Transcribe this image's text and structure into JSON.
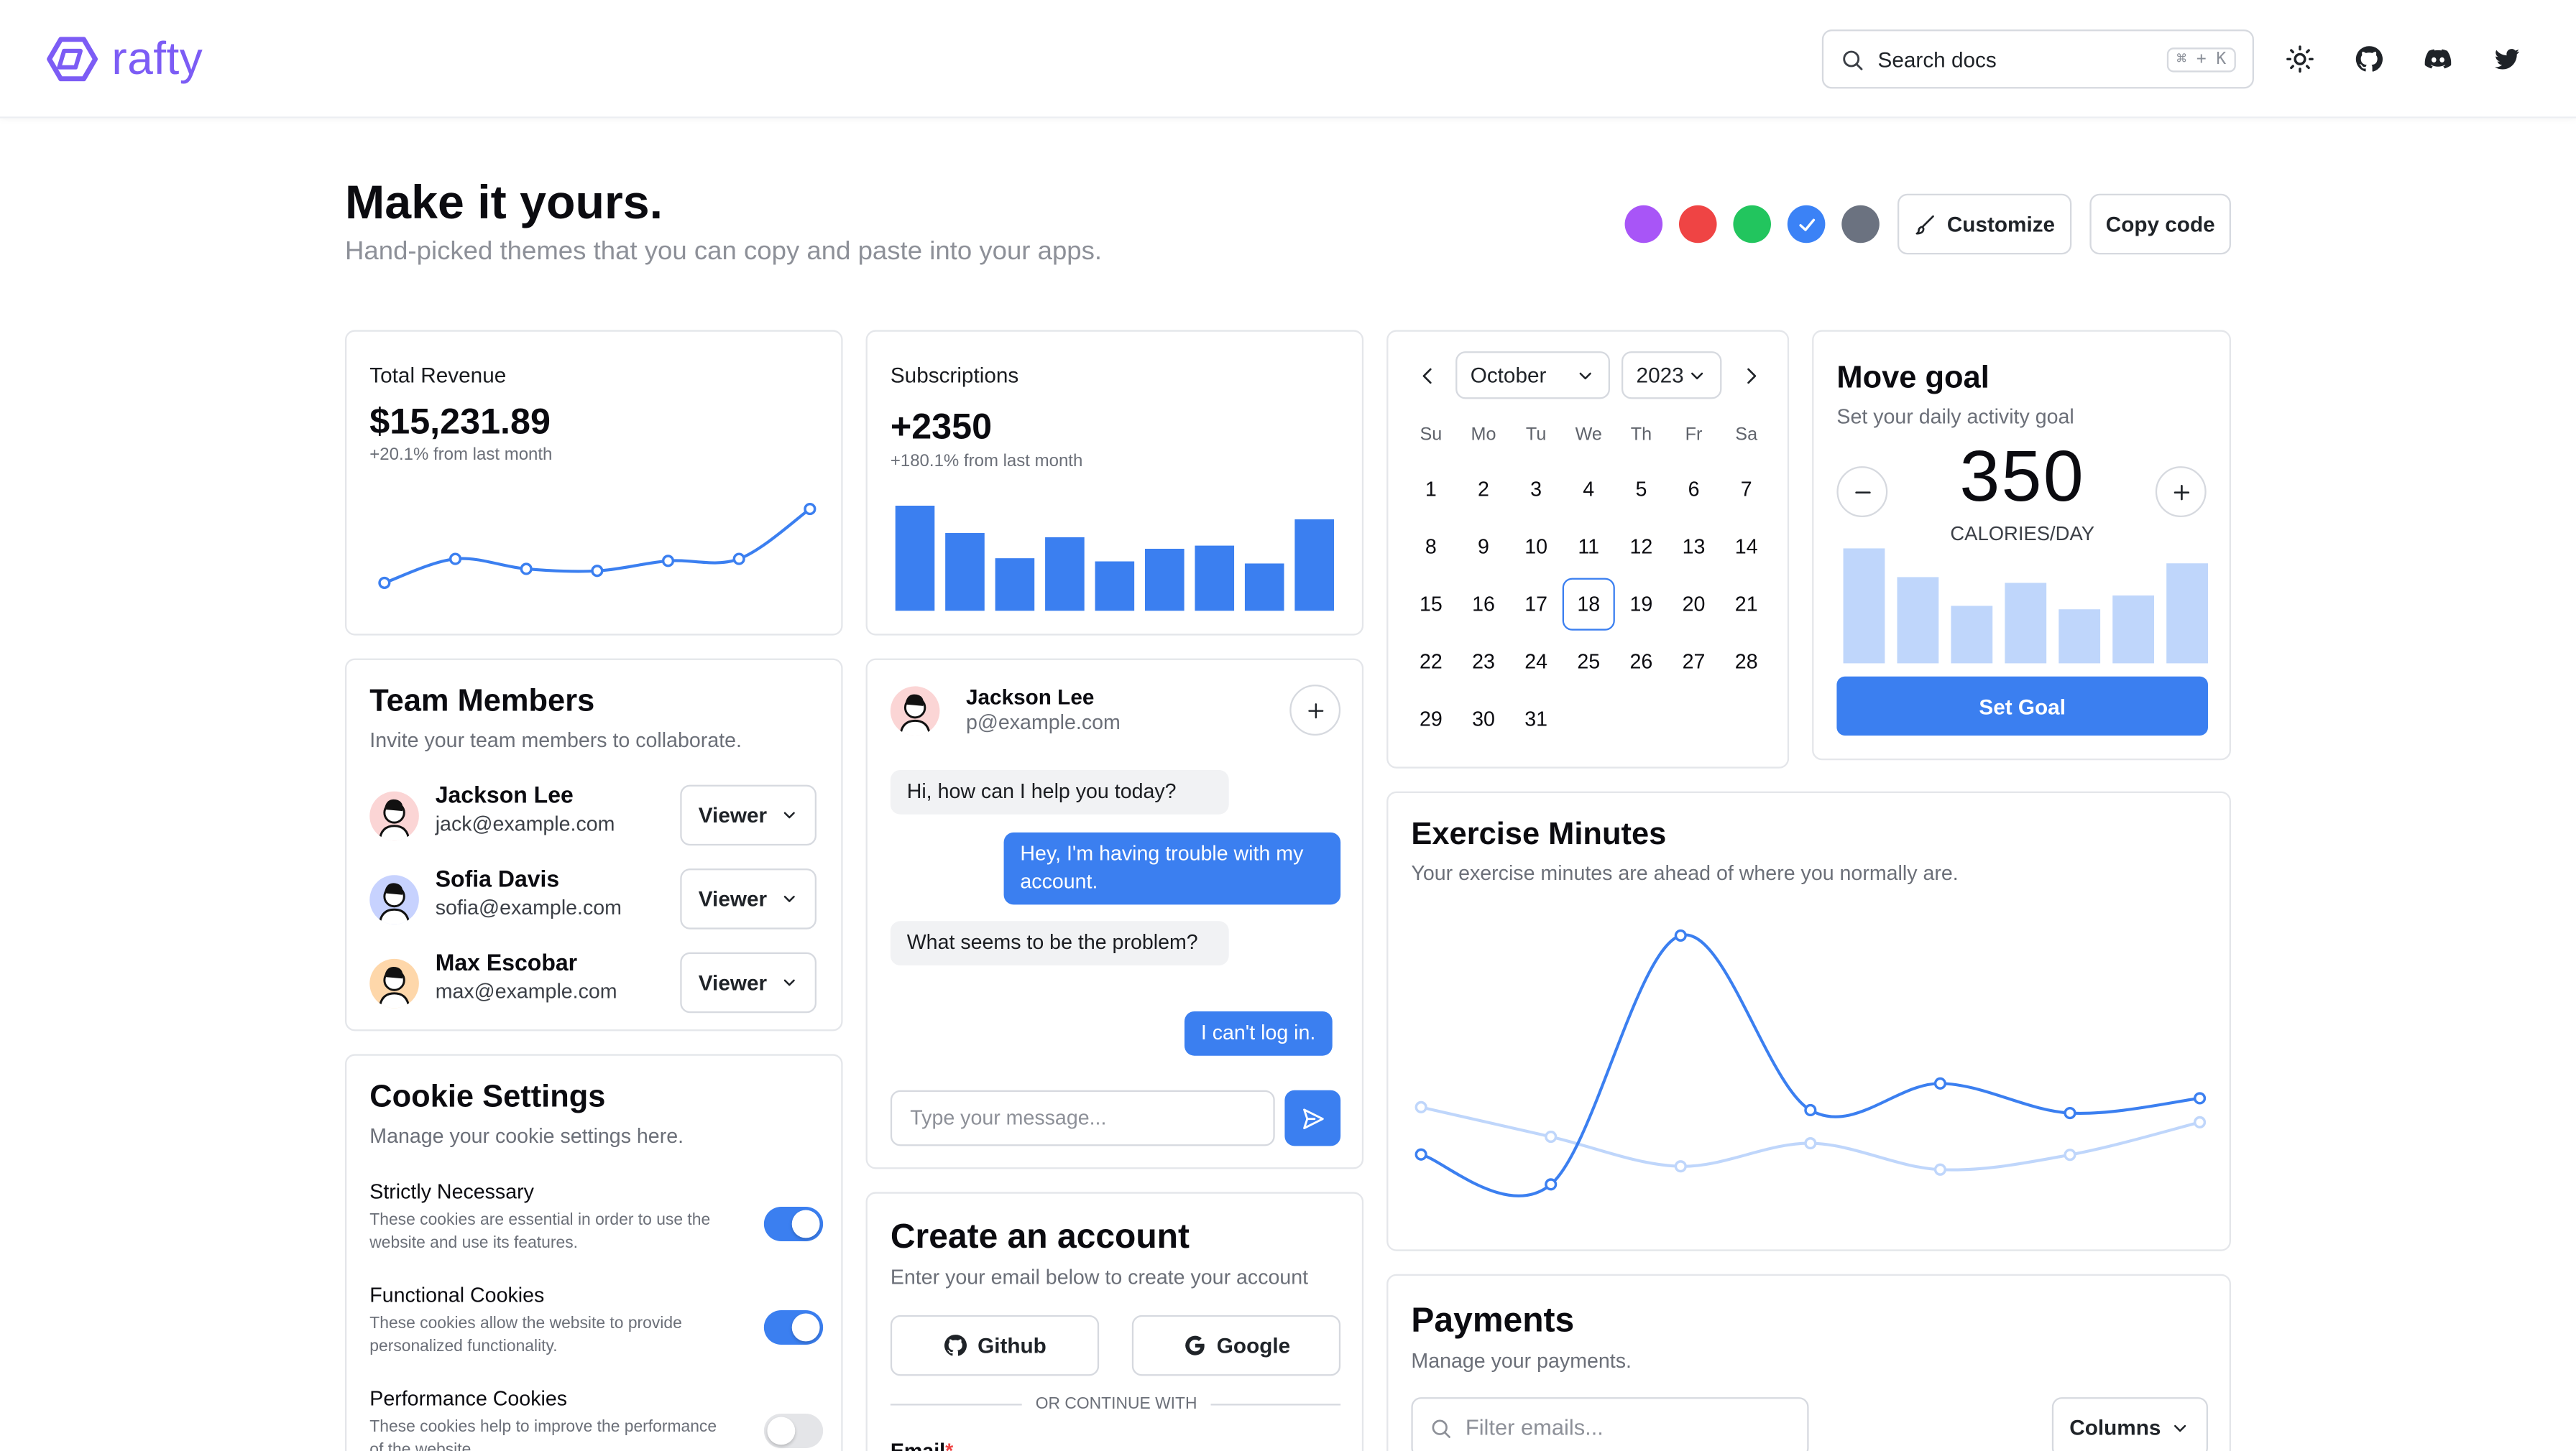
{
  "header": {
    "brand": "rafty",
    "search_placeholder": "Search docs",
    "search_shortcut": "⌘ + K",
    "icons": [
      "theme-toggle-icon",
      "github-icon",
      "discord-icon",
      "twitter-icon"
    ]
  },
  "hero": {
    "title": "Make it yours.",
    "subtitle": "Hand-picked themes that you can copy and paste into your apps.",
    "swatches": [
      "#a855f7",
      "#ef4444",
      "#22c55e",
      "#3b82f6",
      "#6b7280"
    ],
    "selected_swatch": "#3b82f6",
    "customize_label": "Customize",
    "copy_label": "Copy code"
  },
  "revenue": {
    "title": "Total Revenue",
    "value": "$15,231.89",
    "change": "+20.1% from last month",
    "chart_data": {
      "type": "line",
      "values": [
        10,
        22,
        17,
        16,
        21,
        22,
        47
      ]
    }
  },
  "subscriptions": {
    "title": "Subscriptions",
    "value": "+2350",
    "change": "+180.1% from last month",
    "chart_data": {
      "type": "bar",
      "values": [
        100,
        74,
        50,
        70,
        47,
        59,
        62,
        45,
        87
      ]
    }
  },
  "calendar": {
    "month": "October",
    "year": "2023",
    "dow": [
      "Su",
      "Mo",
      "Tu",
      "We",
      "Th",
      "Fr",
      "Sa"
    ],
    "weeks": [
      [
        "1",
        "2",
        "3",
        "4",
        "5",
        "6",
        "7"
      ],
      [
        "8",
        "9",
        "10",
        "11",
        "12",
        "13",
        "14"
      ],
      [
        "15",
        "16",
        "17",
        "18",
        "19",
        "20",
        "21"
      ],
      [
        "22",
        "23",
        "24",
        "25",
        "26",
        "27",
        "28"
      ],
      [
        "29",
        "30",
        "31"
      ]
    ],
    "selected": "18"
  },
  "goal": {
    "title": "Move goal",
    "desc": "Set your daily activity goal",
    "value": "350",
    "unit": "CALORIES/DAY",
    "button": "Set Goal",
    "chart_data": {
      "type": "bar",
      "values": [
        100,
        75,
        50,
        70,
        47,
        59,
        87
      ]
    }
  },
  "team": {
    "title": "Team Members",
    "desc": "Invite your team members to collaborate.",
    "members": [
      {
        "name": "Jackson Lee",
        "email": "jack@example.com",
        "role": "Viewer",
        "avatar_bg": "#fbd5d5"
      },
      {
        "name": "Sofia Davis",
        "email": "sofia@example.com",
        "role": "Viewer",
        "avatar_bg": "#c7d2fe"
      },
      {
        "name": "Max Escobar",
        "email": "max@example.com",
        "role": "Viewer",
        "avatar_bg": "#fed7aa"
      }
    ]
  },
  "chat": {
    "name": "Jackson Lee",
    "email": "p@example.com",
    "messages": [
      {
        "from": "in",
        "text": "Hi, how can I help you today?"
      },
      {
        "from": "out",
        "text": "Hey, I'm having trouble with my account."
      },
      {
        "from": "in",
        "text": "What seems to be the problem?"
      },
      {
        "from": "out",
        "text": "I can't log in."
      }
    ],
    "input_placeholder": "Type your message..."
  },
  "exercise": {
    "title": "Exercise Minutes",
    "desc": "Your exercise minutes are ahead of where you normally are.",
    "chart_data": {
      "type": "line",
      "series": [
        {
          "values": [
            240,
            139,
            980,
            390,
            480,
            380,
            430
          ]
        },
        {
          "values": [
            400,
            300,
            200,
            278,
            189,
            239,
            349
          ]
        }
      ]
    }
  },
  "cookies": {
    "title": "Cookie Settings",
    "desc": "Manage your cookie settings here.",
    "items": [
      {
        "title": "Strictly Necessary",
        "desc": "These cookies are essential in order to use the website and use its features.",
        "on": true
      },
      {
        "title": "Functional Cookies",
        "desc": "These cookies allow the website to provide personalized functionality.",
        "on": true
      },
      {
        "title": "Performance Cookies",
        "desc": "These cookies help to improve the performance of the website.",
        "on": false
      }
    ]
  },
  "account": {
    "title": "Create an account",
    "desc": "Enter your email below to create your account",
    "github": "Github",
    "google": "Google",
    "divider": "OR CONTINUE WITH",
    "email_label": "Email",
    "required_mark": "*"
  },
  "payments": {
    "title": "Payments",
    "desc": "Manage your payments.",
    "filter_placeholder": "Filter emails...",
    "columns_label": "Columns"
  },
  "colors": {
    "primary": "#3b7ff0",
    "primary_light": "#bfd6fb",
    "brand": "#7c5cf5"
  }
}
